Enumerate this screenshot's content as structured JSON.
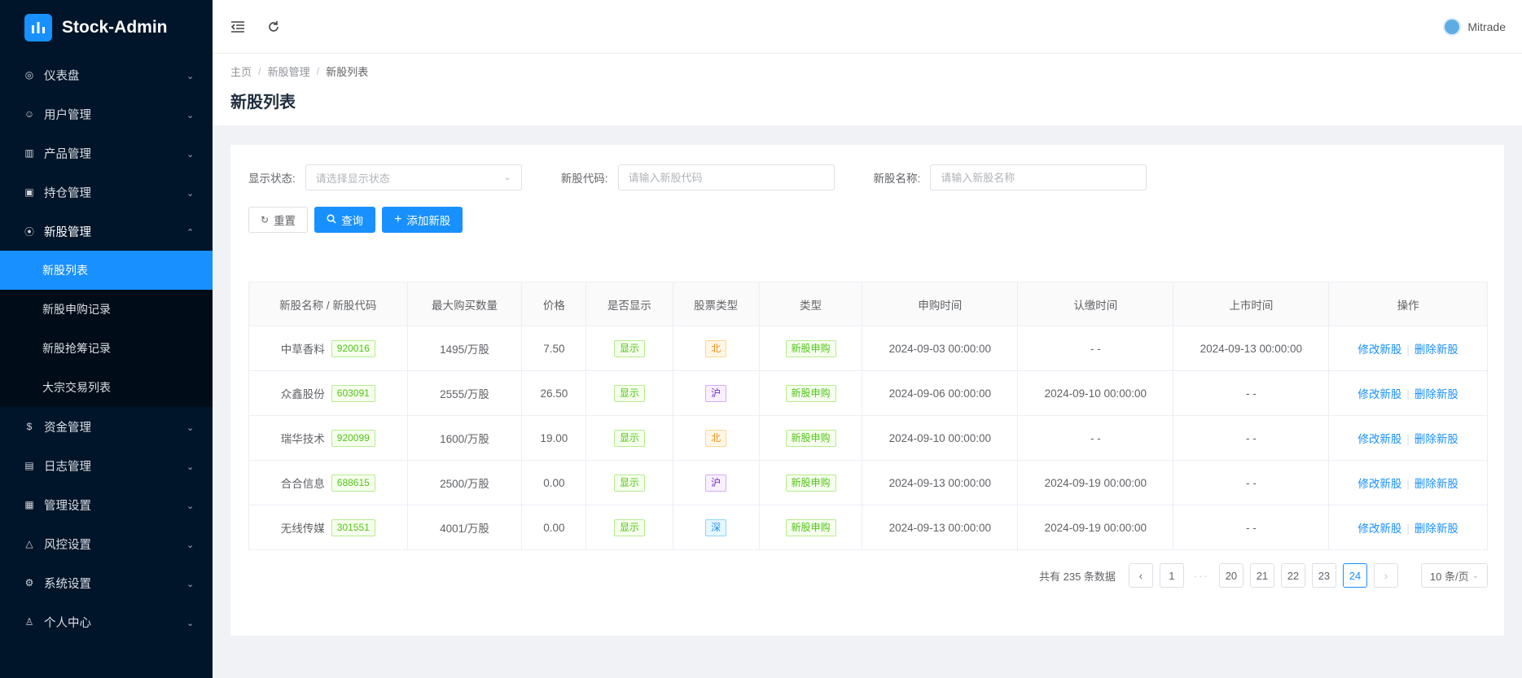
{
  "brand": {
    "title": "Stock-Admin"
  },
  "sidebar": {
    "items": [
      {
        "label": "仪表盘",
        "icon": "dashboard-icon"
      },
      {
        "label": "用户管理",
        "icon": "users-icon"
      },
      {
        "label": "产品管理",
        "icon": "chart-icon"
      },
      {
        "label": "持仓管理",
        "icon": "position-icon"
      },
      {
        "label": "新股管理",
        "icon": "ipo-icon",
        "open": true,
        "children": [
          {
            "label": "新股列表",
            "active": true
          },
          {
            "label": "新股申购记录"
          },
          {
            "label": "新股抢筹记录"
          },
          {
            "label": "大宗交易列表"
          }
        ]
      },
      {
        "label": "资金管理",
        "icon": "money-icon"
      },
      {
        "label": "日志管理",
        "icon": "log-icon"
      },
      {
        "label": "管理设置",
        "icon": "admin-icon"
      },
      {
        "label": "风控设置",
        "icon": "warning-icon"
      },
      {
        "label": "系统设置",
        "icon": "gear-icon"
      },
      {
        "label": "个人中心",
        "icon": "person-icon"
      }
    ]
  },
  "header": {
    "username": "Mitrade"
  },
  "breadcrumb": {
    "home": "主页",
    "section": "新股管理",
    "current": "新股列表"
  },
  "page": {
    "title": "新股列表"
  },
  "filters": {
    "status_label": "显示状态:",
    "status_placeholder": "请选择显示状态",
    "code_label": "新股代码:",
    "code_placeholder": "请输入新股代码",
    "name_label": "新股名称:",
    "name_placeholder": "请输入新股名称"
  },
  "buttons": {
    "reset": "重置",
    "query": "查询",
    "add": "添加新股"
  },
  "table": {
    "headers": [
      "新股名称 / 新股代码",
      "最大购买数量",
      "价格",
      "是否显示",
      "股票类型",
      "类型",
      "申购时间",
      "认缴时间",
      "上市时间",
      "操作"
    ],
    "rows": [
      {
        "name": "中草香料",
        "code": "920016",
        "max": "1495/万股",
        "price": "7.50",
        "show": "显示",
        "market": "北",
        "market_color": "orange",
        "type": "新股申购",
        "apply": "2024-09-03 00:00:00",
        "pay": "- -",
        "list": "2024-09-13 00:00:00"
      },
      {
        "name": "众鑫股份",
        "code": "603091",
        "max": "2555/万股",
        "price": "26.50",
        "show": "显示",
        "market": "沪",
        "market_color": "purple",
        "type": "新股申购",
        "apply": "2024-09-06 00:00:00",
        "pay": "2024-09-10 00:00:00",
        "list": "- -"
      },
      {
        "name": "瑞华技术",
        "code": "920099",
        "max": "1600/万股",
        "price": "19.00",
        "show": "显示",
        "market": "北",
        "market_color": "orange",
        "type": "新股申购",
        "apply": "2024-09-10 00:00:00",
        "pay": "- -",
        "list": "- -"
      },
      {
        "name": "合合信息",
        "code": "688615",
        "max": "2500/万股",
        "price": "0.00",
        "show": "显示",
        "market": "沪",
        "market_color": "purple",
        "type": "新股申购",
        "apply": "2024-09-13 00:00:00",
        "pay": "2024-09-19 00:00:00",
        "list": "- -"
      },
      {
        "name": "无线传媒",
        "code": "301551",
        "max": "4001/万股",
        "price": "0.00",
        "show": "显示",
        "market": "深",
        "market_color": "blue",
        "type": "新股申购",
        "apply": "2024-09-13 00:00:00",
        "pay": "2024-09-19 00:00:00",
        "list": "- -"
      }
    ],
    "op_edit": "修改新股",
    "op_delete": "删除新股"
  },
  "pagination": {
    "total_text": "共有 235 条数据",
    "pages": [
      "1",
      "20",
      "21",
      "22",
      "23",
      "24"
    ],
    "current": "24",
    "page_size": "10 条/页"
  },
  "colors": {
    "primary": "#1890ff",
    "sidebar_bg": "#001529"
  }
}
